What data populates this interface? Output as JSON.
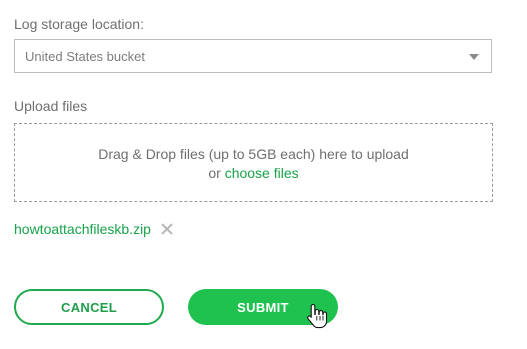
{
  "storage": {
    "label": "Log storage location:",
    "selected_value": "United States bucket"
  },
  "upload": {
    "label": "Upload files",
    "dropzone_text": "Drag & Drop files (up to 5GB each) here to upload",
    "dropzone_or": "or",
    "choose_files_link": "choose files"
  },
  "attached_file": {
    "name": "howtoattachfileskb.zip",
    "remove_icon": "close-icon"
  },
  "actions": {
    "cancel_label": "CANCEL",
    "submit_label": "SUBMIT"
  },
  "colors": {
    "accent_green": "#1fc24f",
    "link_green": "#17a34a"
  }
}
